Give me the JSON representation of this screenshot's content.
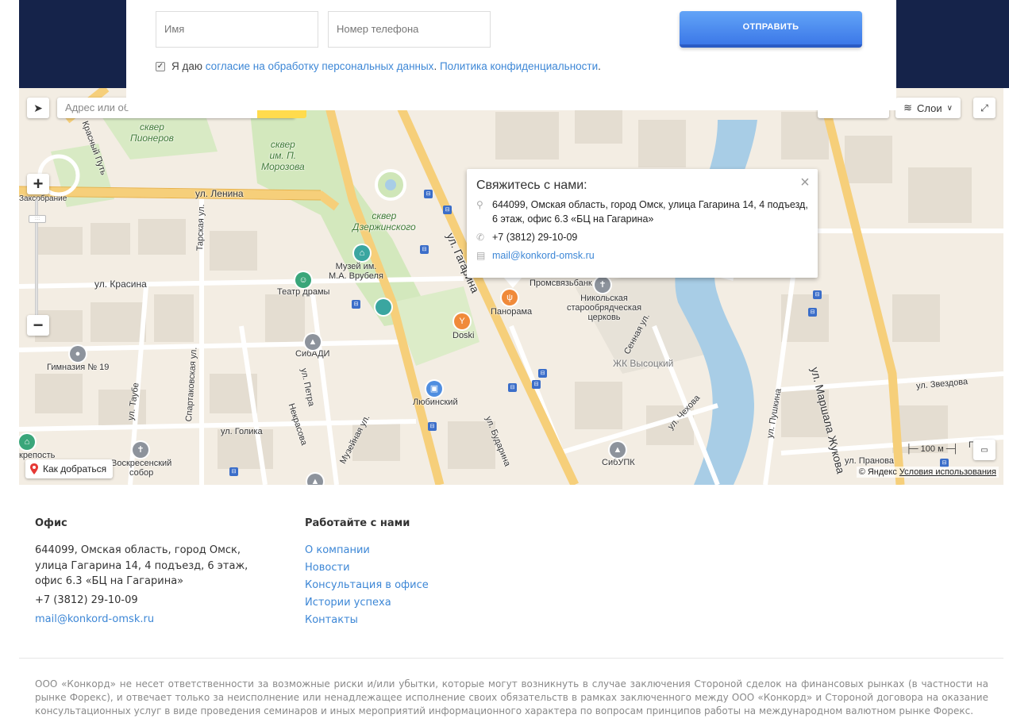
{
  "form": {
    "name_placeholder": "Имя",
    "phone_placeholder": "Номер телефона",
    "submit_label": "ОТПРАВИТЬ",
    "consent_prefix": "Я даю",
    "consent_link": "согласие на обработку персональных данных",
    "consent_sep": ".",
    "privacy_link": "Политика конфиденциальности",
    "privacy_suffix": ".",
    "consent_checked": true
  },
  "map": {
    "search_placeholder": "Адрес или об",
    "layers_label": "Слои",
    "howto_label": "Как добраться",
    "copyright_prefix": "© Яндекс",
    "terms_link": "Условия использования",
    "scale_label": "100 м",
    "labels": {
      "lenina": "ул. Ленина",
      "krasina": "ул. Красина",
      "skver_pionerov_1": "сквер",
      "skver_pionerov_2": "Пионеров",
      "skver_morozova_1": "сквер",
      "skver_morozova_2": "им. П.",
      "skver_morozova_3": "Морозова",
      "skver_dzer_1": "сквер",
      "skver_dzer_2": "Дзержинского",
      "muzey_1": "Музей им.",
      "muzey_2": "М.А. Врубеля",
      "teatr": "Театр драмы",
      "sibadi": "СибАДИ",
      "gimnaziya": "Гимназия № 19",
      "doski": "Doski",
      "lyubinsky": "Любинский",
      "panorama": "Панорама",
      "promsvyaz": "Промсвязьбанк",
      "church_1": "Никольская",
      "church_2": "старообрядческая",
      "church_3": "церковь",
      "zhk": "ЖК Высоцкий",
      "sibupk": "СибУПК",
      "zhukova": "ул. Маршала Жукова",
      "zvezdova": "ул. Звездова",
      "pranova": "ул. Пранова",
      "golika": "ул. Голика",
      "chekhova": "ул. Чехова",
      "pushkina": "ул. Пушкина",
      "budarina": "ул. Бударина",
      "gagarina": "ул. Гагарина",
      "muzeynaya": "Музейная ул.",
      "petra": "ул. Петра",
      "nekrasova": "Некрасова",
      "spartakovskaya": "Спартаковская ул.",
      "taube": "ул. Таубе",
      "tarskaya": "Тарская ул.",
      "sennaya": "Сенная ул.",
      "voskresensky_1": "Воскресенский",
      "voskresensky_2": "собор",
      "krepost": "крепость",
      "krasny_put": "Красный Путь",
      "sakso_1": "О",
      "sakso_2": "Заксобрание",
      "pr": "Прав"
    }
  },
  "balloon": {
    "title": "Свяжитесь с нами:",
    "address": "644099, Омская область, город Омск, улица Гагарина 14, 4 подъезд, 6 этаж, офис 6.3 «БЦ на Гагарина»",
    "phone": "+7 (3812) 29-10-09",
    "email": "mail@konkord-omsk.ru"
  },
  "footer": {
    "office_title": "Офис",
    "office_address_1": "644099, Омская область, город Омск,",
    "office_address_2": "улица Гагарина 14, 4 подъезд, 6 этаж,",
    "office_address_3": "офис 6.3 «БЦ на Гагарина»",
    "office_phone": "+7 (3812) 29-10-09",
    "office_email": "mail@konkord-omsk.ru",
    "work_title": "Работайте с нами",
    "links": [
      "О компании",
      "Новости",
      "Консультация в офисе",
      "Истории успеха",
      "Контакты"
    ],
    "disclaimer": "ООО «Конкорд» не несет ответственности за возможные риски и/или убытки, которые могут возникнуть в случае заключения Стороной сделок на финансовых рынках (в частности на рынке Форекс), и отвечает только за неисполнение или ненадлежащее исполнение своих обязательств в рамках заключенного между ООО «Конкорд» и Стороной договора на оказание консультационных услуг в виде проведения семинаров и иных мероприятий информационного характера по вопросам принципов работы на международном валютном рынке Форекс."
  },
  "colors": {
    "navy": "#15234a",
    "accent": "#3d87d6",
    "button": "#3c78e8",
    "road_major": "#f6cf7a",
    "river": "#a8cde6",
    "park": "#cfe6b8"
  }
}
